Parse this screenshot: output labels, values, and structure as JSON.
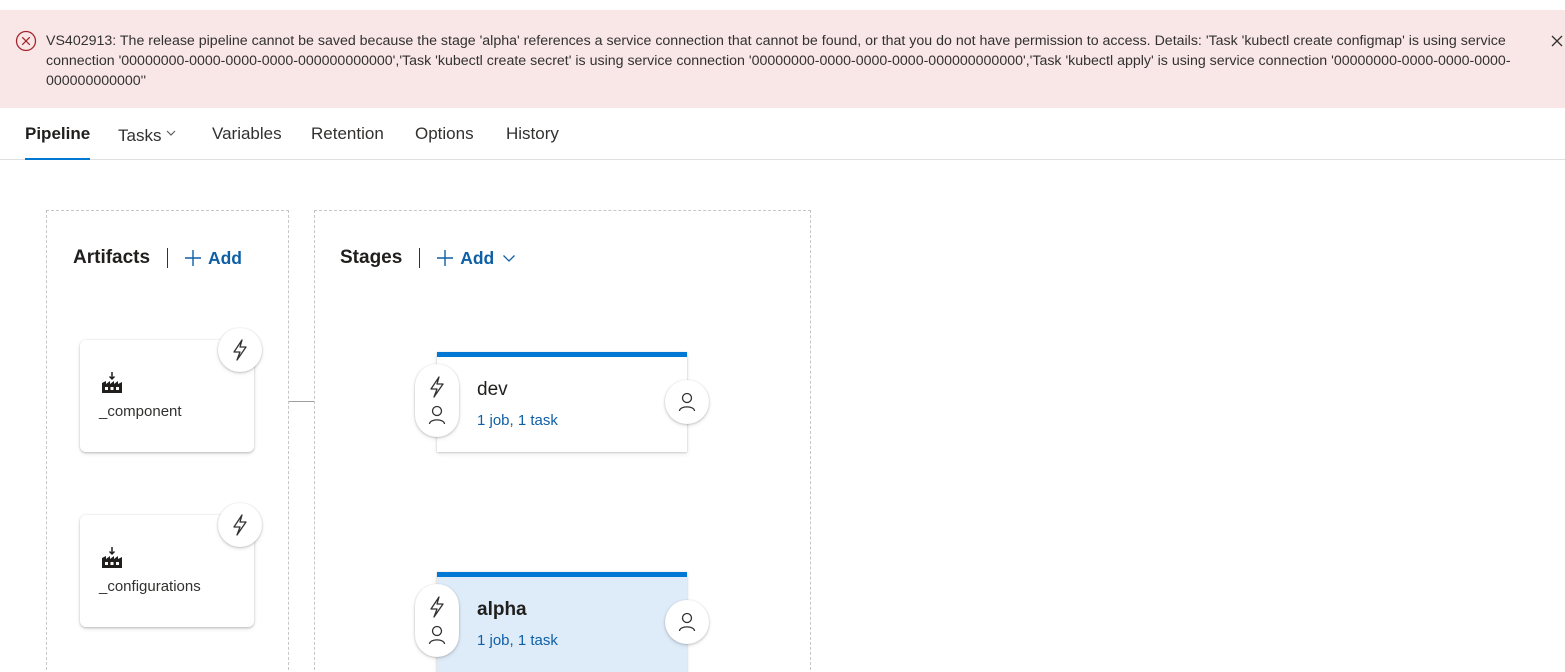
{
  "error": {
    "message": "VS402913: The release pipeline cannot be saved because the stage 'alpha' references a service connection that cannot be found, or that you do not have permission to access. Details: 'Task 'kubectl create configmap' is using service connection '00000000-0000-0000-0000-000000000000','Task 'kubectl create secret' is using service connection '00000000-0000-0000-0000-000000000000','Task 'kubectl apply' is using service connection '00000000-0000-0000-0000-000000000000''",
    "icon": "error-circle-icon",
    "close_icon": "close-icon",
    "background_color": "#f9e7e8",
    "icon_color": "#a4262c"
  },
  "tabs": [
    {
      "label": "Pipeline",
      "active": true
    },
    {
      "label": "Tasks",
      "has_dropdown": true
    },
    {
      "label": "Variables"
    },
    {
      "label": "Retention"
    },
    {
      "label": "Options"
    },
    {
      "label": "History"
    }
  ],
  "artifacts": {
    "title": "Artifacts",
    "add_label": "Add",
    "items": [
      {
        "name": "_component",
        "icon": "build-artifact-icon",
        "trigger_icon": "lightning-icon"
      },
      {
        "name": "_configurations",
        "icon": "build-artifact-icon",
        "trigger_icon": "lightning-icon"
      }
    ]
  },
  "stages": {
    "title": "Stages",
    "add_label": "Add",
    "items": [
      {
        "name": "dev",
        "summary": "1 job, 1 task",
        "selected": false
      },
      {
        "name": "alpha",
        "summary": "1 job, 1 task",
        "selected": true
      }
    ]
  },
  "colors": {
    "accent": "#0078d4",
    "link": "#0f5fa6",
    "selected_stage_bg": "#deecf9"
  }
}
